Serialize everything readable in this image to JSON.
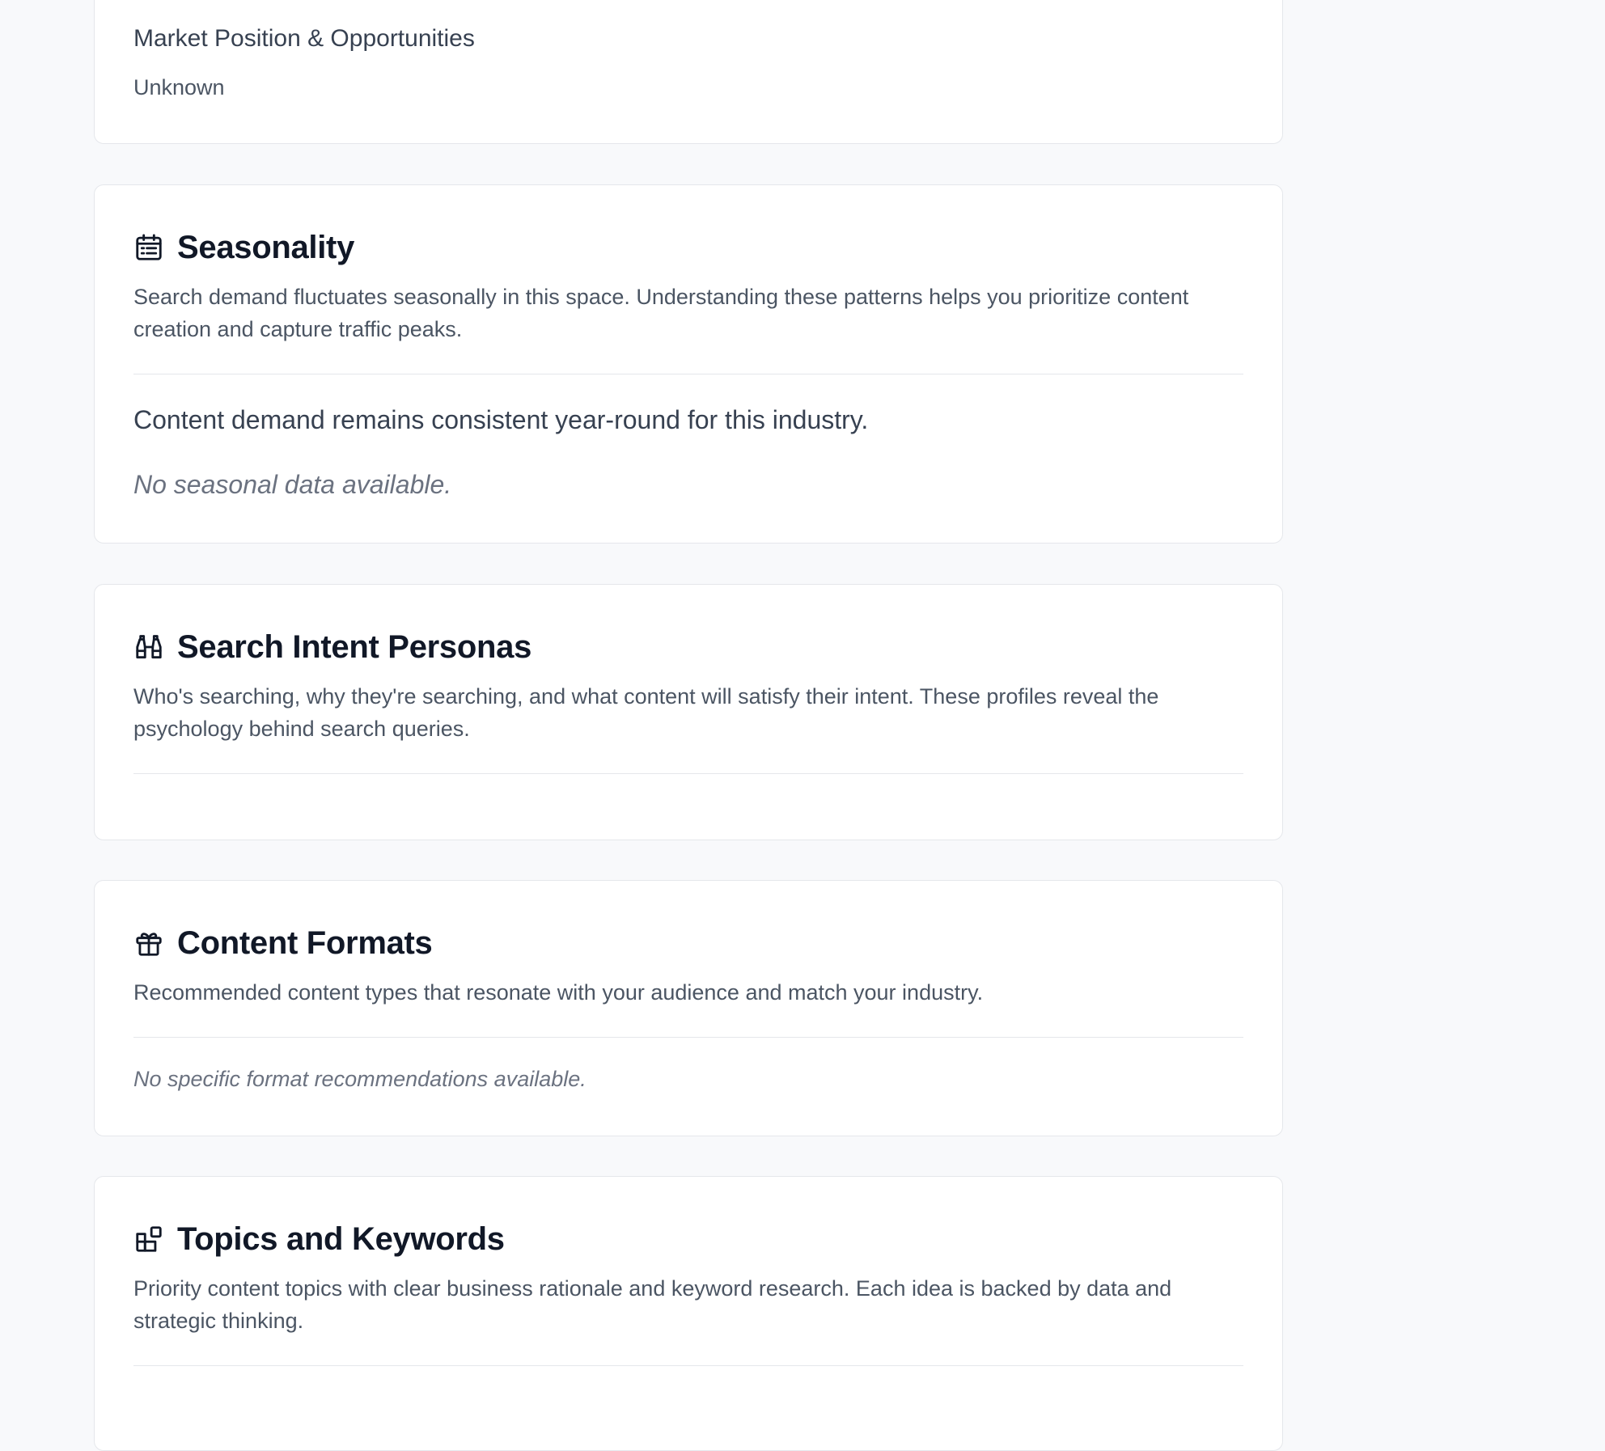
{
  "market": {
    "title": "Market Position & Opportunities",
    "value": "Unknown"
  },
  "seasonality": {
    "icon": "calendar-icon",
    "title": "Seasonality",
    "description": "Search demand fluctuates seasonally in this space. Understanding these patterns helps you prioritize content creation and capture traffic peaks.",
    "summary": "Content demand remains consistent year-round for this industry.",
    "empty": "No seasonal data available."
  },
  "personas": {
    "icon": "binoculars-icon",
    "title": "Search Intent Personas",
    "description": "Who's searching, why they're searching, and what content will satisfy their intent. These profiles reveal the psychology behind search queries."
  },
  "formats": {
    "icon": "gift-icon",
    "title": "Content Formats",
    "description": "Recommended content types that resonate with your audience and match your industry.",
    "empty": "No specific format recommendations available."
  },
  "topics": {
    "icon": "widgets-icon",
    "title": "Topics and Keywords",
    "description": "Priority content topics with clear business rationale and keyword research. Each idea is backed by data and strategic thinking."
  }
}
